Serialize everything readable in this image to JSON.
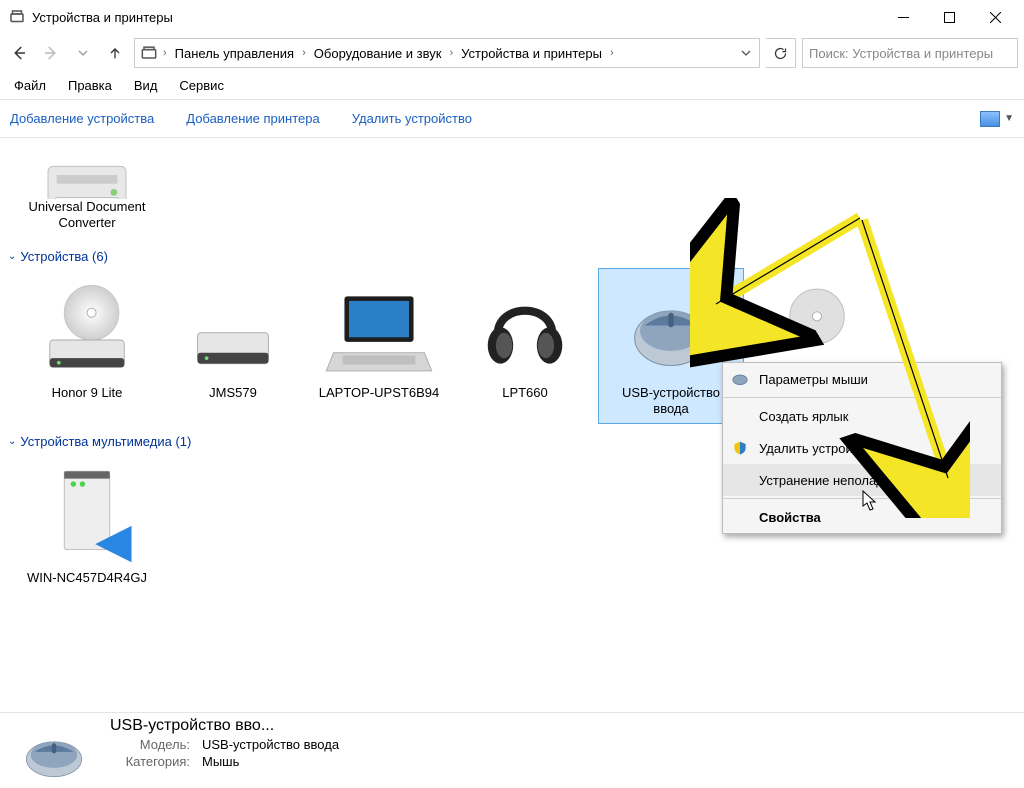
{
  "window": {
    "title": "Устройства и принтеры"
  },
  "breadcrumb": {
    "items": [
      "Панель управления",
      "Оборудование и звук",
      "Устройства и принтеры"
    ]
  },
  "search": {
    "placeholder": "Поиск: Устройства и принтеры"
  },
  "menubar": {
    "file": "Файл",
    "edit": "Правка",
    "view": "Вид",
    "service": "Сервис"
  },
  "toolbar": {
    "add_device": "Добавление устройства",
    "add_printer": "Добавление принтера",
    "remove_device": "Удалить устройство"
  },
  "groups": {
    "printers_device": "Universal Document Converter",
    "devices_header": "Устройства (6)",
    "devices": [
      "Honor 9 Lite",
      "JMS579",
      "LAPTOP-UPST6B94",
      "LPT660",
      "USB-устройство ввода"
    ],
    "multimedia_header": "Устройства мультимедиа (1)",
    "multimedia_device": "WIN-NC457D4R4GJ"
  },
  "context_menu": {
    "mouse_settings": "Параметры мыши",
    "create_shortcut": "Создать ярлык",
    "remove_device": "Удалить устройство",
    "troubleshoot": "Устранение неполадок",
    "properties": "Свойства"
  },
  "details": {
    "title": "USB-устройство вво...",
    "model_label": "Модель:",
    "model_value": "USB-устройство ввода",
    "category_label": "Категория:",
    "category_value": "Мышь"
  }
}
